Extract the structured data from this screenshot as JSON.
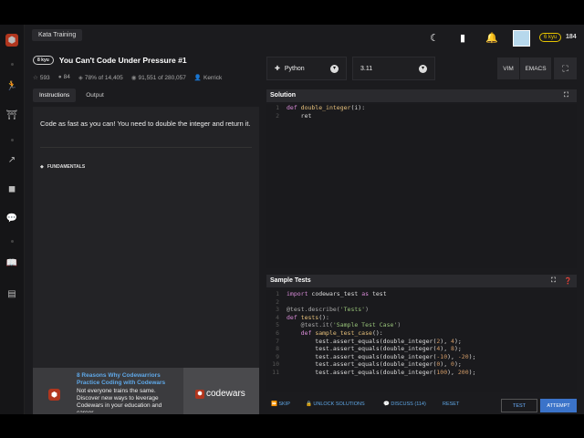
{
  "app": {
    "breadcrumb": "Kata Training"
  },
  "header": {
    "honor": "184",
    "rank": "6 kyu"
  },
  "kata": {
    "kyu": "8 kyu",
    "title": "You Can't Code Under Pressure #1",
    "stars": "593",
    "comments": "84",
    "satisfaction": "78% of 14,405",
    "completed": "91,551 of 280,057",
    "author": "Kerrick",
    "tabs": [
      "Instructions",
      "Output"
    ],
    "description": "Code as fast as you can! You need to double the integer and return it.",
    "tag": "FUNDAMENTALS"
  },
  "ad": {
    "title": "8 Reasons Why Codewarriors Practice Coding with Codewars",
    "body": "Not everyone trains the same. Discover new ways to leverage Codewars in your education and career.",
    "brand": "codewars"
  },
  "editor": {
    "language": "Python",
    "version": "3.11",
    "modes": [
      "VIM",
      "EMACS"
    ],
    "solution_title": "Solution",
    "sample_title": "Sample Tests"
  },
  "footer": {
    "skip": "SKIP",
    "unlock": "UNLOCK SOLUTIONS",
    "discuss": "DISCUSS (114)",
    "reset": "RESET",
    "test": "TEST",
    "attempt": "ATTEMPT"
  },
  "colors": {
    "brand": "#b1361e",
    "accent": "#3b73c9",
    "rank": "#e5c300"
  },
  "icons": [
    "logo-icon",
    "moon-icon",
    "bookmark-icon",
    "bell-icon",
    "python-icon",
    "chevron-down-icon",
    "fullscreen-icon",
    "help-icon"
  ]
}
